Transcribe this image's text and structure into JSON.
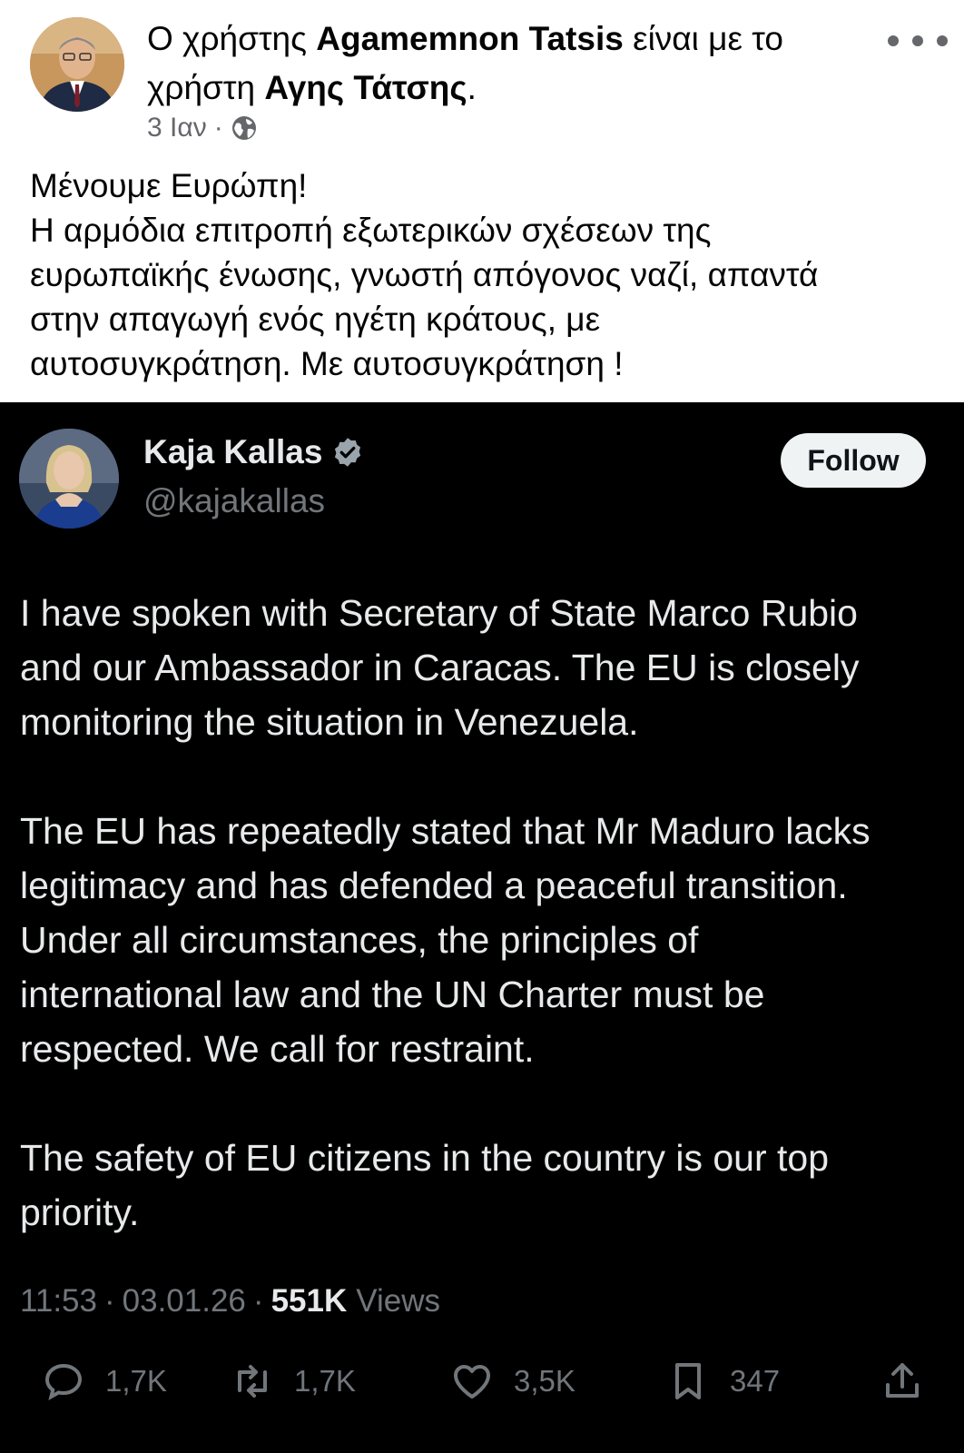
{
  "fb_post": {
    "header_prefix": "Ο χρήστης ",
    "author": "Agamemnon Tatsis",
    "header_middle": " είναι με το",
    "header_line2_prefix": "χρήστη ",
    "tagged": "Αγης Τάτσης",
    "header_suffix": ".",
    "date": "3 Ιαν",
    "separator": "·",
    "audience_icon": "globe-icon",
    "more_icon": "more-options-icon",
    "text_lines": [
      "Μένουμε Ευρώπη!",
      "Η αρμόδια επιτροπή εξωτερικών σχέσεων της",
      "ευρωπαϊκής ένωσης, γνωστή απόγονος ναζί, απαντά",
      "στην απαγωγή ενός ηγέτη κράτους, με",
      "αυτοσυγκράτηση. Με αυτοσυγκράτηση !"
    ]
  },
  "tweet": {
    "name": "Kaja Kallas",
    "handle": "@kajakallas",
    "follow_label": "Follow",
    "verified_icon": "verified-badge-icon",
    "paragraphs": [
      [
        "I have spoken with Secretary of State Marco Rubio",
        "and our Ambassador in Caracas. The EU is closely",
        "monitoring the situation in Venezuela."
      ],
      [
        "The EU has repeatedly stated that Mr Maduro lacks",
        "legitimacy and has defended a peaceful transition.",
        "Under all circumstances, the principles of",
        "international law and the UN Charter must be",
        "respected. We call for restraint."
      ],
      [
        "The safety of EU citizens in the country is our top",
        "priority."
      ]
    ],
    "time": "11:53",
    "date": "03.01.26",
    "separator": "·",
    "views_count": "551K",
    "views_label": "Views",
    "actions": {
      "replies": "1,7K",
      "retweets": "1,7K",
      "likes": "3,5K",
      "bookmarks": "347"
    }
  },
  "colors": {
    "tweet_bg": "#000000",
    "tweet_text": "#e7e9ea",
    "tweet_muted": "#71767b",
    "fb_muted": "#65676b"
  }
}
